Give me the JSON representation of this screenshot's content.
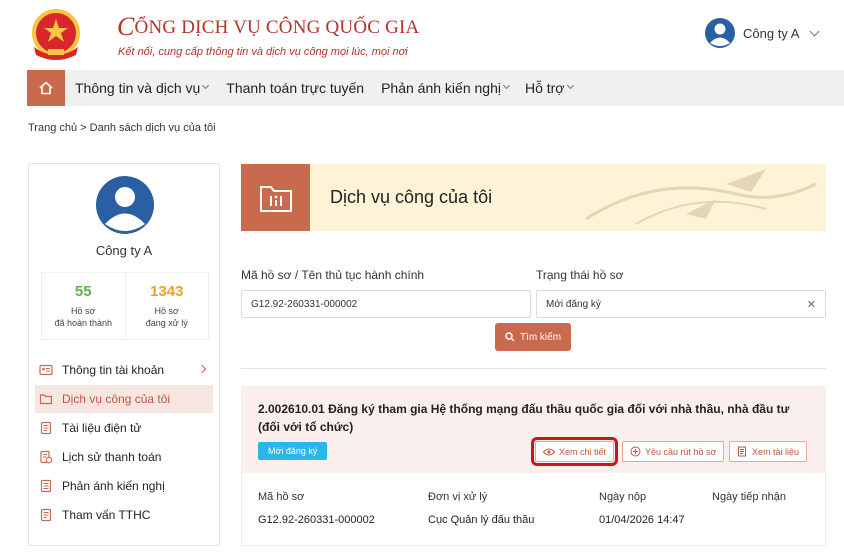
{
  "header": {
    "title_first_letter": "C",
    "title_rest": "ỔNG DỊCH VỤ CÔNG QUỐC GIA",
    "subtitle": "Kết nối, cung cấp thông tin và dịch vụ công mọi lúc, mọi nơi",
    "user_name": "Công ty A"
  },
  "nav": {
    "items": [
      {
        "label": "Thông tin và dịch vụ",
        "has_dropdown": true
      },
      {
        "label": "Thanh toán trực tuyến",
        "has_dropdown": false
      },
      {
        "label": "Phản ánh kiến nghị",
        "has_dropdown": true
      },
      {
        "label": "Hỗ trợ",
        "has_dropdown": true
      }
    ]
  },
  "breadcrumb": "Trang chủ  >  Danh sách dịch vụ của tôi",
  "sidebar": {
    "name": "Công ty A",
    "stats": [
      {
        "value": "55",
        "label_1": "Hồ sơ",
        "label_2": "đã hoàn thành"
      },
      {
        "value": "1343",
        "label_1": "Hồ sơ",
        "label_2": "đang xử lý"
      }
    ],
    "menu": [
      {
        "label": "Thông tin tài khoản",
        "icon": "account-card-icon",
        "active": false
      },
      {
        "label": "Dịch vụ công của tôi",
        "icon": "folder-icon",
        "active": true
      },
      {
        "label": "Tài liệu điện tử",
        "icon": "document-icon",
        "active": false
      },
      {
        "label": "Lịch sử thanh toán",
        "icon": "payment-history-icon",
        "active": false
      },
      {
        "label": "Phản ánh kiến nghị",
        "icon": "feedback-icon",
        "active": false
      },
      {
        "label": "Tham vấn TTHC",
        "icon": "consult-icon",
        "active": false
      }
    ]
  },
  "banner": {
    "title": "Dịch vụ công của tôi"
  },
  "search": {
    "code_label": "Mã hồ sơ / Tên thủ tục hành chính",
    "code_value": "G12.92-260331-000002",
    "status_label": "Trạng thái hồ sơ",
    "status_value": "Mới đăng ký",
    "button_label": "Tìm kiếm"
  },
  "result": {
    "title": "2.002610.01 Đăng ký tham gia Hệ thống mạng đấu thầu quốc gia đối với nhà thầu, nhà đầu tư (đối với tổ chức)",
    "badge": "Mới đăng ký",
    "actions": {
      "view_detail": "Xem chi tiết",
      "withdraw": "Yêu cầu rút hồ sơ",
      "view_docs": "Xem tài liệu"
    },
    "columns": {
      "code": "Mã hồ sơ",
      "unit": "Đơn vị xử lý",
      "submit_date": "Ngày nộp",
      "receive_date": "Ngày tiếp nhận"
    },
    "values": {
      "code": "G12.92-260331-000002",
      "unit": "Cục Quản lý đấu thầu",
      "submit_date": "01/04/2026 14:47",
      "receive_date": ""
    }
  },
  "colors": {
    "accent": "#c9694e",
    "brand_red": "#b4322a",
    "badge_blue": "#29b6e8",
    "highlight_box": "#c8171c"
  }
}
